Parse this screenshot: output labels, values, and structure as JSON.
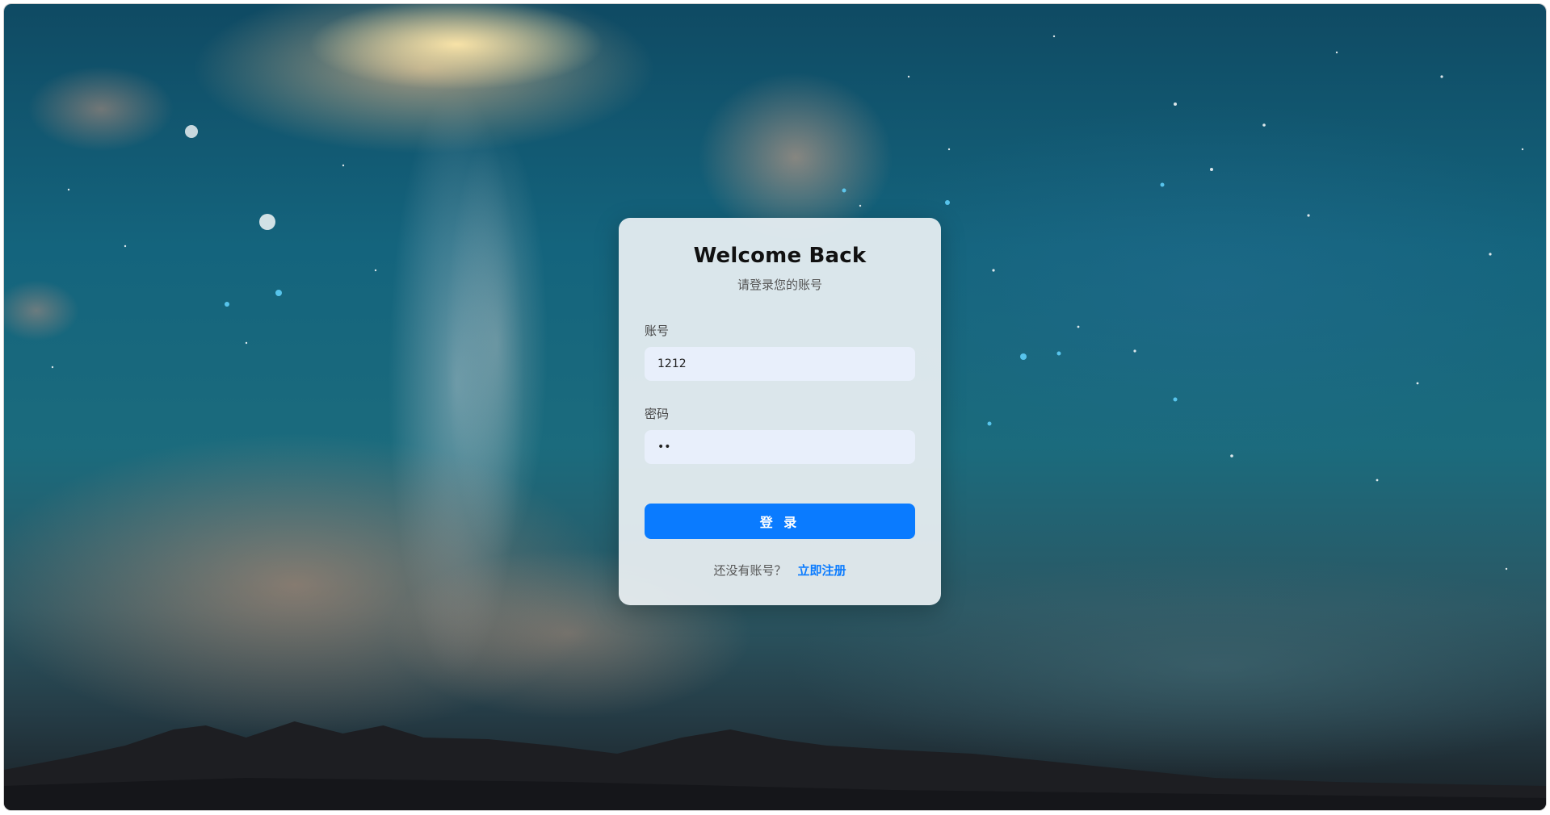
{
  "login": {
    "title": "Welcome Back",
    "subtitle": "请登录您的账号",
    "username_label": "账号",
    "username_value": "1212",
    "password_label": "密码",
    "password_value": "12",
    "login_button": "登 录",
    "no_account_text": "还没有账号？",
    "register_link": "立即注册"
  },
  "colors": {
    "accent": "#0a7bff",
    "input_bg": "#e8effb",
    "card_bg": "#ecf1f4"
  }
}
